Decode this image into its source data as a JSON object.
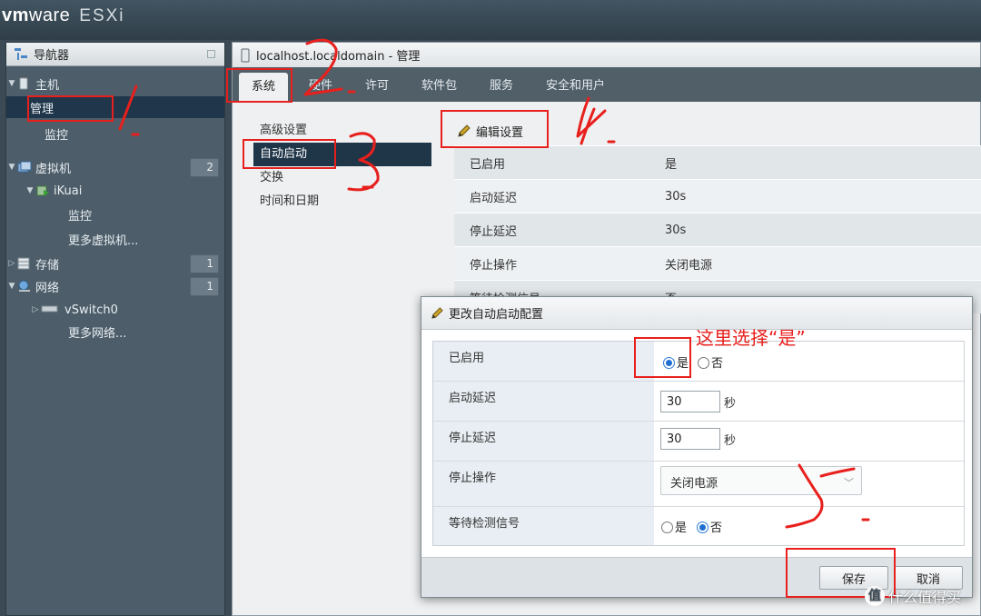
{
  "brand": {
    "vm": "vm",
    "ware": "ware",
    "product": "ESXi"
  },
  "navigator": {
    "title": "导航器",
    "items": [
      {
        "label": "主机"
      },
      {
        "label": "管理"
      },
      {
        "label": "监控"
      },
      {
        "label": "虚拟机",
        "count": "2"
      },
      {
        "label": "iKuai"
      },
      {
        "label": "监控"
      },
      {
        "label": "更多虚拟机..."
      },
      {
        "label": "存储",
        "count": "1"
      },
      {
        "label": "网络",
        "count": "1"
      },
      {
        "label": "vSwitch0"
      },
      {
        "label": "更多网络..."
      }
    ]
  },
  "main": {
    "title": "localhost.localdomain - 管理",
    "tabs": [
      "系统",
      "硬件",
      "许可",
      "软件包",
      "服务",
      "安全和用户"
    ],
    "submenu": [
      "高级设置",
      "自动启动",
      "交换",
      "时间和日期"
    ],
    "edit_label": "编辑设置",
    "settings": [
      {
        "key": "已启用",
        "value": "是"
      },
      {
        "key": "启动延迟",
        "value": "30s"
      },
      {
        "key": "停止延迟",
        "value": "30s"
      },
      {
        "key": "停止操作",
        "value": "关闭电源"
      },
      {
        "key": "等待检测信号",
        "value": "否"
      }
    ]
  },
  "dialog": {
    "title": "更改自动启动配置",
    "enabled_label": "已启用",
    "yes": "是",
    "no": "否",
    "start_delay_label": "启动延迟",
    "start_delay_value": "30",
    "stop_delay_label": "停止延迟",
    "stop_delay_value": "30",
    "unit": "秒",
    "stop_action_label": "停止操作",
    "stop_action_value": "关闭电源",
    "heartbeat_label": "等待检测信号",
    "save": "保存",
    "cancel": "取消"
  },
  "annotation": {
    "note": "这里选择“是”",
    "color": "#e8201d"
  },
  "watermark": {
    "icon": "值",
    "text": "什么值得买"
  }
}
